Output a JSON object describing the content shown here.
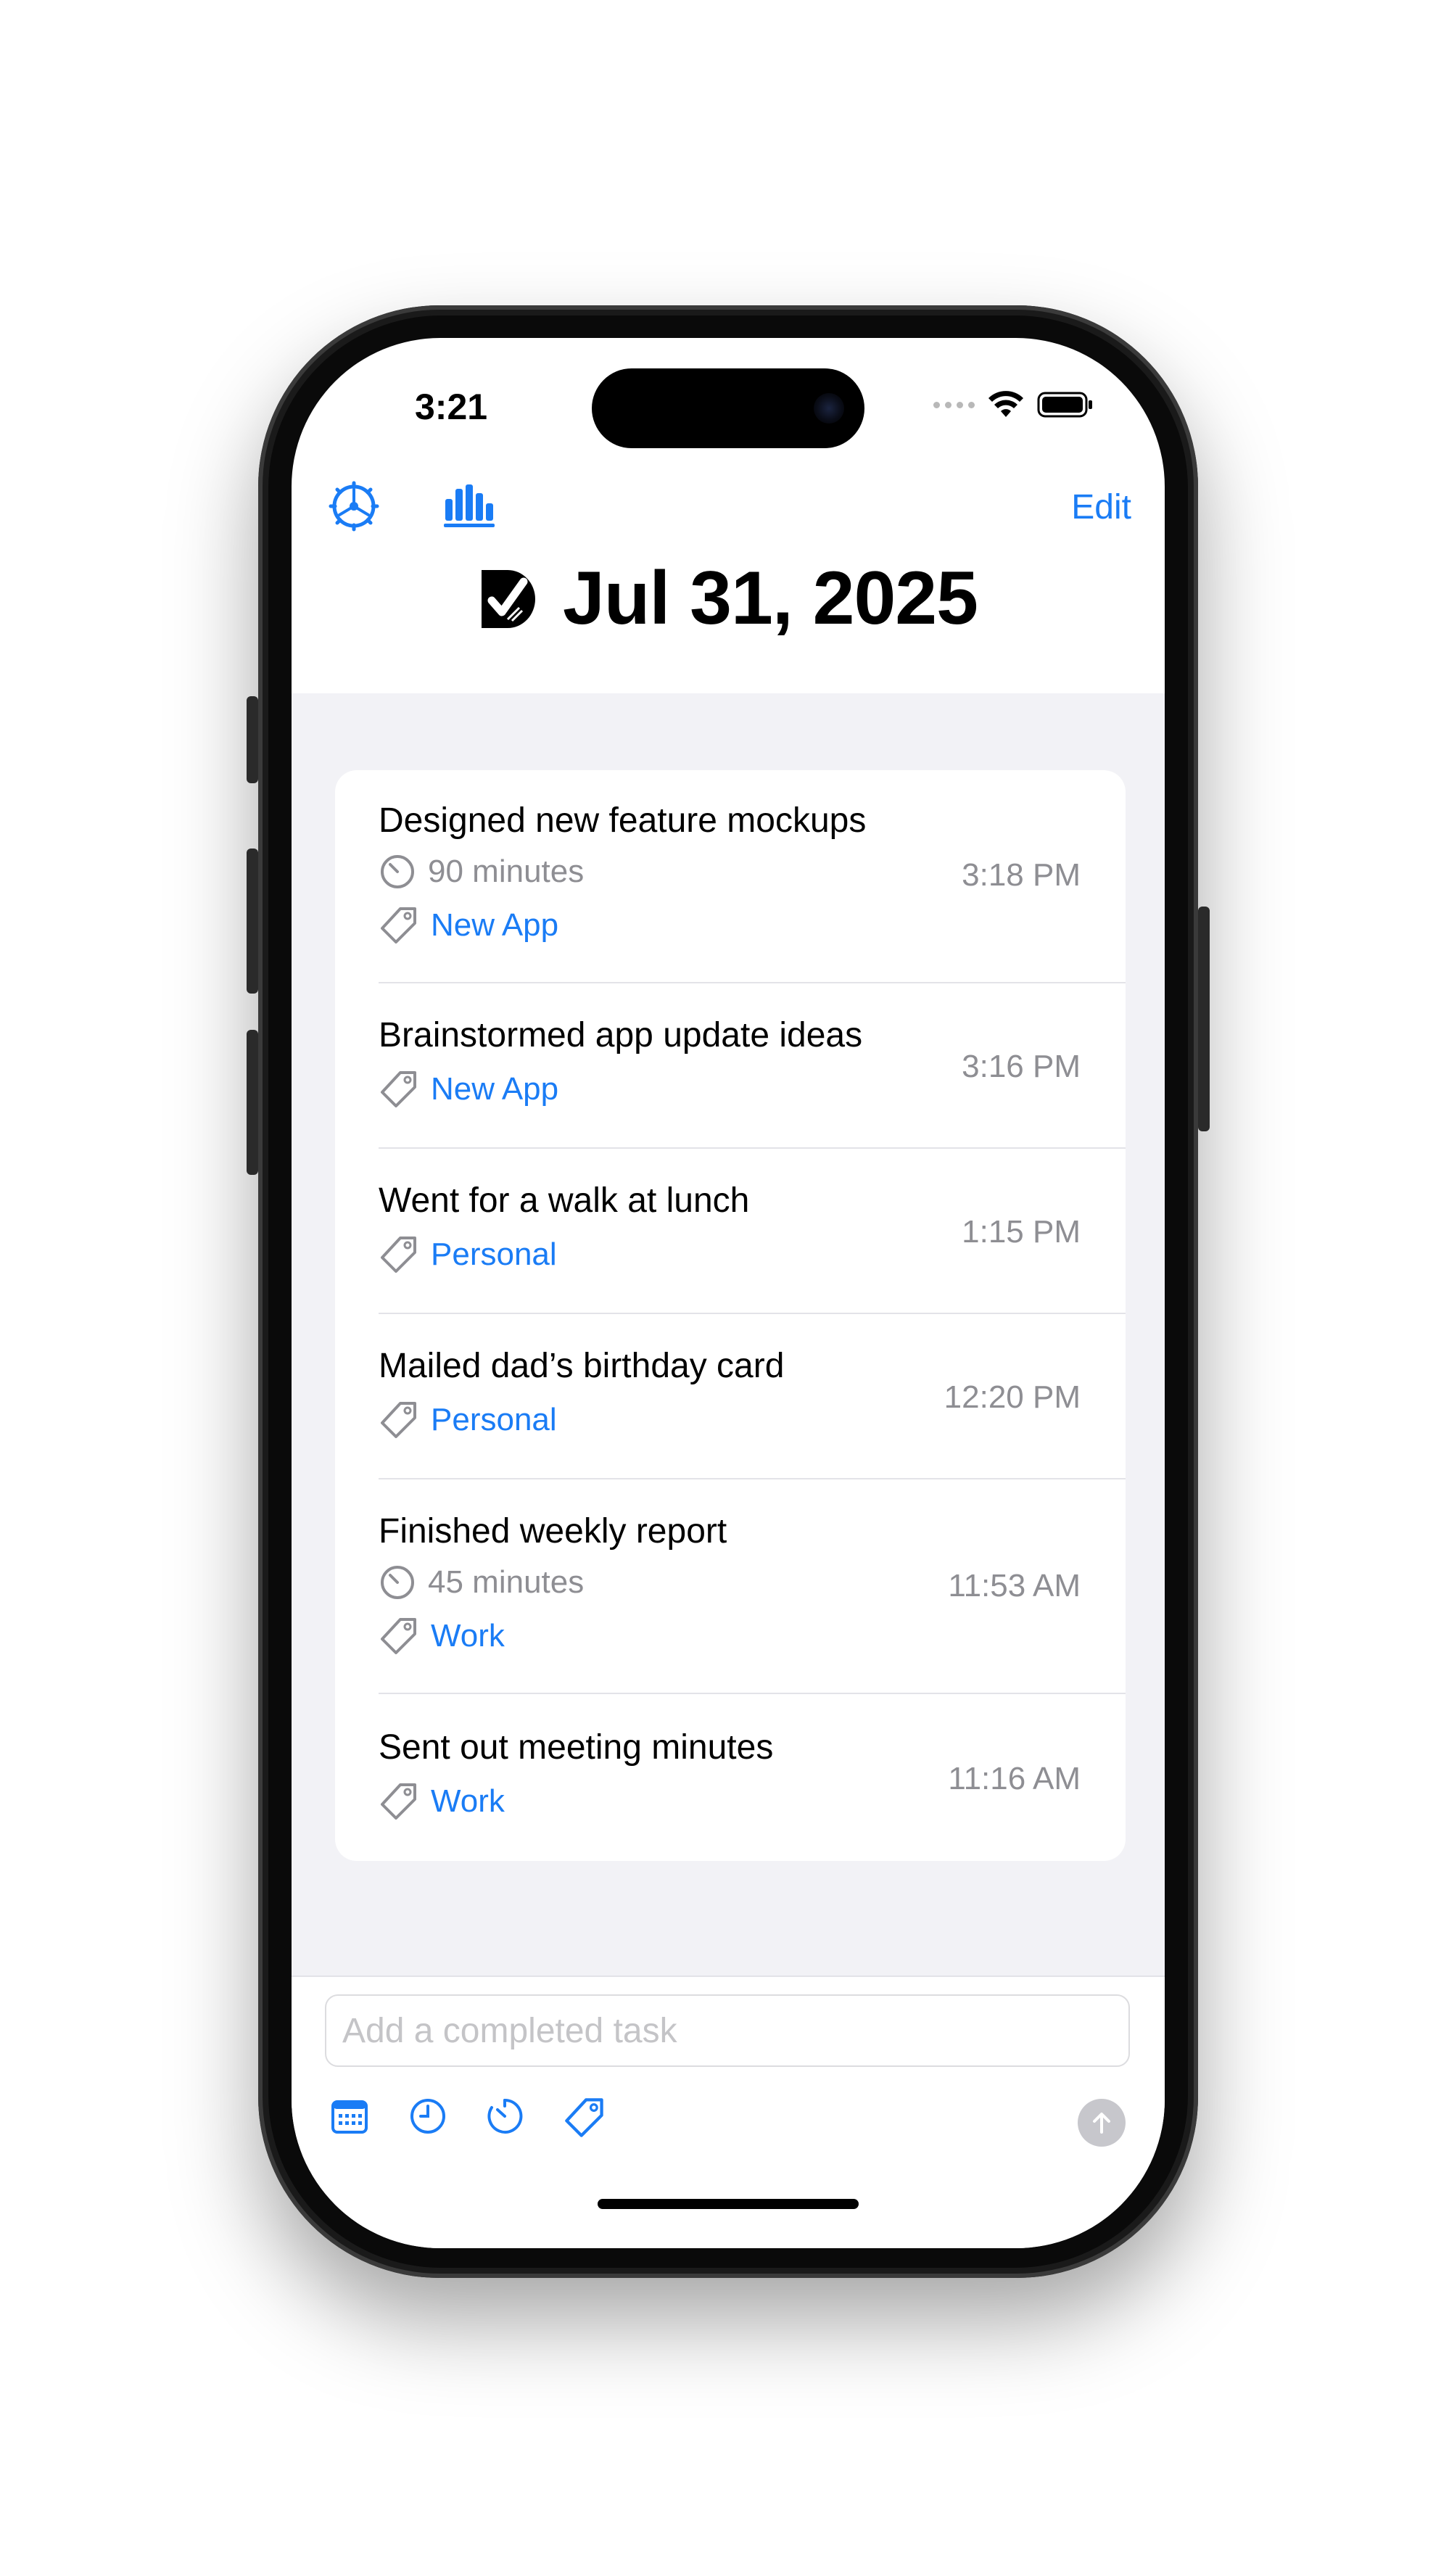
{
  "status_bar": {
    "time": "3:21"
  },
  "nav": {
    "edit_label": "Edit",
    "title": "Jul 31, 2025"
  },
  "tasks": [
    {
      "title": "Designed new feature mockups",
      "duration": "90 minutes",
      "tag": "New App",
      "time": "3:18 PM"
    },
    {
      "title": "Brainstormed app update ideas",
      "tag": "New App",
      "time": "3:16 PM"
    },
    {
      "title": "Went for a walk at lunch",
      "tag": "Personal",
      "time": "1:15 PM"
    },
    {
      "title": "Mailed dad’s birthday card",
      "tag": "Personal",
      "time": "12:20 PM"
    },
    {
      "title": "Finished weekly report",
      "duration": "45 minutes",
      "tag": "Work",
      "time": "11:53 AM"
    },
    {
      "title": "Sent out meeting minutes",
      "tag": "Work",
      "time": "11:16 AM"
    }
  ],
  "composer": {
    "placeholder": "Add a completed task"
  },
  "colors": {
    "accent": "#1a7cf5",
    "secondary_text": "#8e8e93",
    "list_background": "#f2f2f6",
    "send_disabled": "#c7c7cc"
  },
  "icons": [
    "settings-gear-icon",
    "stats-bar-chart-icon",
    "app-logo-icon",
    "stopwatch-icon",
    "tag-icon",
    "calendar-icon",
    "clock-icon",
    "timer-icon",
    "send-arrow-icon"
  ]
}
